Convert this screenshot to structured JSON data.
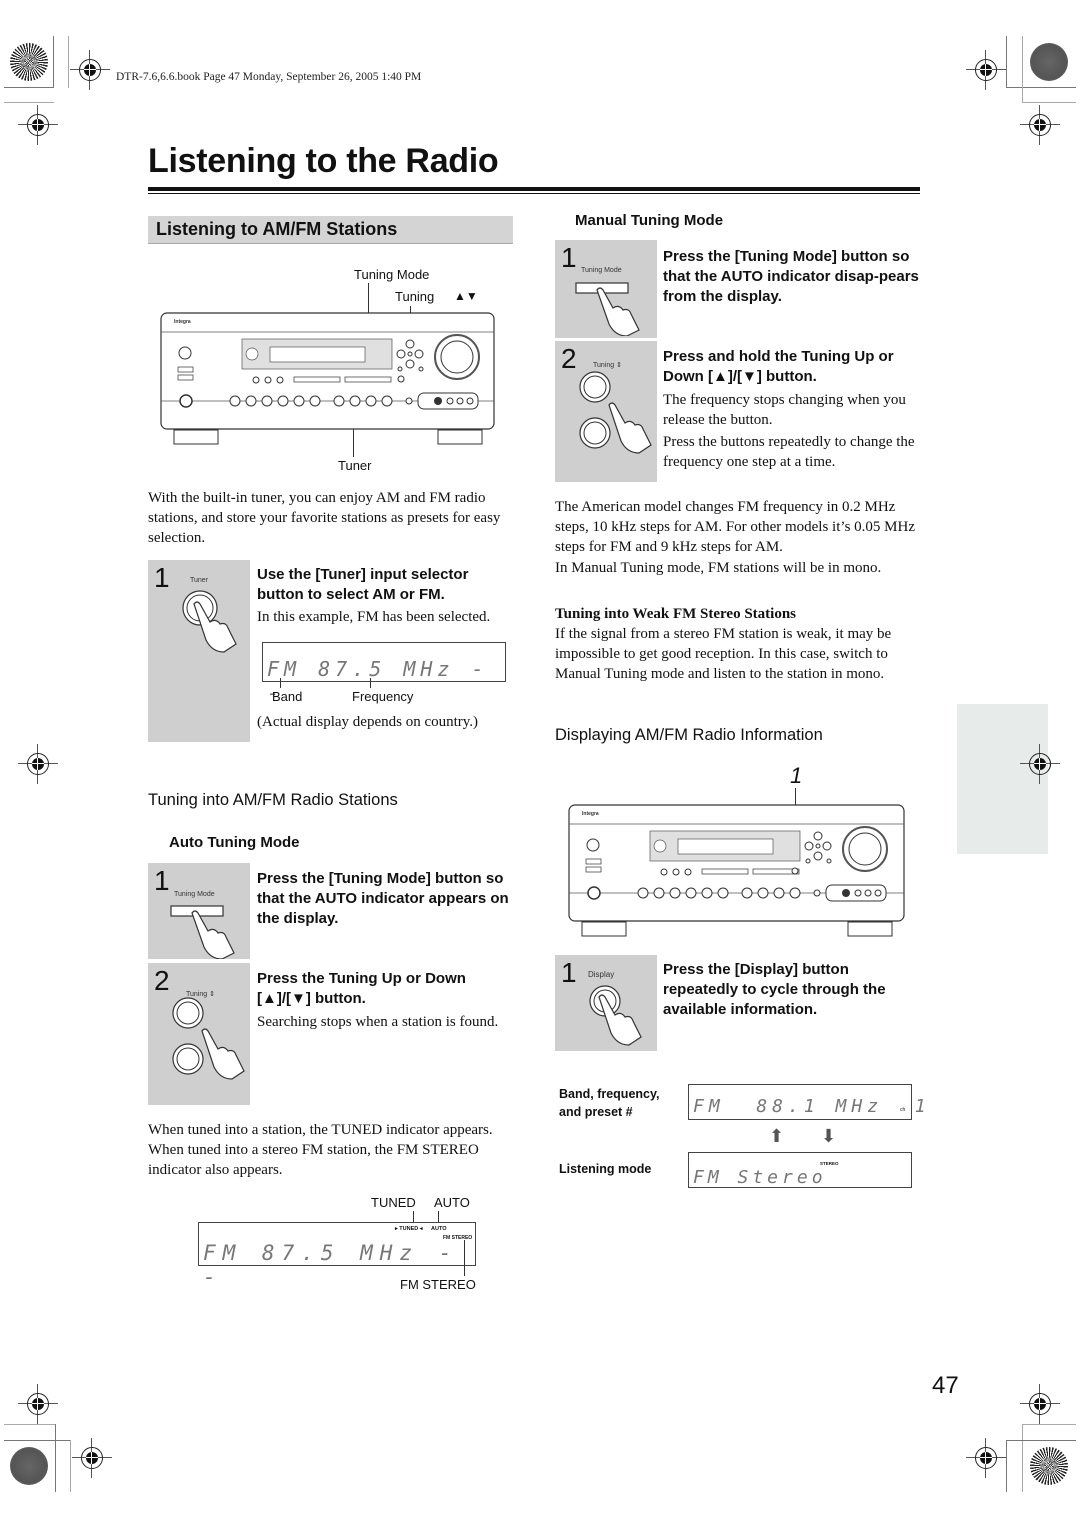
{
  "header": {
    "print_meta": "DTR-7.6,6.6.book  Page 47  Monday, September 26, 2005  1:40 PM"
  },
  "page": {
    "title": "Listening to the Radio",
    "number": "47"
  },
  "left": {
    "section_title": "Listening to AM/FM Stations",
    "receiver_diagram": {
      "callouts": {
        "tuning_mode": "Tuning Mode",
        "tuning": "Tuning",
        "tuning_arrows": "▲▼",
        "tuner": "Tuner"
      },
      "brand": "Integra"
    },
    "intro": "With the built-in tuner, you can enjoy AM and FM radio stations, and store your favorite stations as presets for easy selection.",
    "step1": {
      "number": "1",
      "image_label": "Tuner",
      "heading": "Use the [Tuner] input selector button to select AM or FM.",
      "text": "In this example, FM has been selected.",
      "display": "FM  87.5 MHz --",
      "band_label": "Band",
      "frequency_label": "Frequency",
      "note": "(Actual display depends on country.)"
    },
    "tuning_subhead": "Tuning into AM/FM Radio Stations",
    "auto_mode": {
      "heading": "Auto Tuning Mode",
      "steps": [
        {
          "number": "1",
          "image_label": "Tuning Mode",
          "heading": "Press the [Tuning Mode] button so that the AUTO indicator appears on the display.",
          "text": ""
        },
        {
          "number": "2",
          "image_label": "Tuning ⇕",
          "heading": "Press the Tuning Up or Down [▲]/[▼] button.",
          "text": "Searching stops when a station is found."
        }
      ]
    },
    "tuned_text": "When tuned into a station, the TUNED indicator appears. When tuned into a stereo FM station, the FM STEREO indicator also appears.",
    "tuned_display": {
      "tuned_label": "TUNED",
      "auto_label": "AUTO",
      "fm_stereo_label": "FM STEREO",
      "ind_tuned": "▸ TUNED ◂",
      "ind_auto": "AUTO",
      "ind_fm_stereo": "FM STEREO",
      "text": "FM  87.5 MHz --"
    }
  },
  "right": {
    "manual_mode": {
      "heading": "Manual Tuning Mode",
      "steps": [
        {
          "number": "1",
          "image_label": "Tuning Mode",
          "heading": "Press the [Tuning Mode] button so that the AUTO indicator disap-pears from the display.",
          "text": ""
        },
        {
          "number": "2",
          "image_label": "Tuning ⇕",
          "heading": "Press and hold the Tuning Up or Down [▲]/[▼] button.",
          "text": "The frequency stops changing when you release the button.",
          "text2": "Press the buttons repeatedly to change the frequency one step at a time."
        }
      ]
    },
    "steps_note": "The American model changes FM frequency in 0.2 MHz steps, 10 kHz steps for AM. For other models it’s 0.05 MHz steps for FM and 9 kHz steps for AM.",
    "mono_note": "In Manual Tuning mode, FM stations will be in mono.",
    "weak": {
      "heading": "Tuning into Weak FM Stereo Stations",
      "text": "If the signal from a stereo FM station is weak, it may be impossible to get good reception. In this case, switch to Manual Tuning mode and listen to the station in mono."
    },
    "display_info": {
      "subhead": "Displaying AM/FM Radio Information",
      "callout": "1",
      "brand": "Integra",
      "step": {
        "number": "1",
        "image_label": "Display",
        "heading": "Press the [Display] button repeatedly to cycle through the available information."
      },
      "rows": [
        {
          "label": "Band, frequency, and preset #",
          "display": "FM  88.1 MHz  1",
          "suffix": "ch"
        },
        {
          "label": "Listening mode",
          "display": "FM Stereo",
          "indicator": "STEREO"
        }
      ]
    }
  }
}
